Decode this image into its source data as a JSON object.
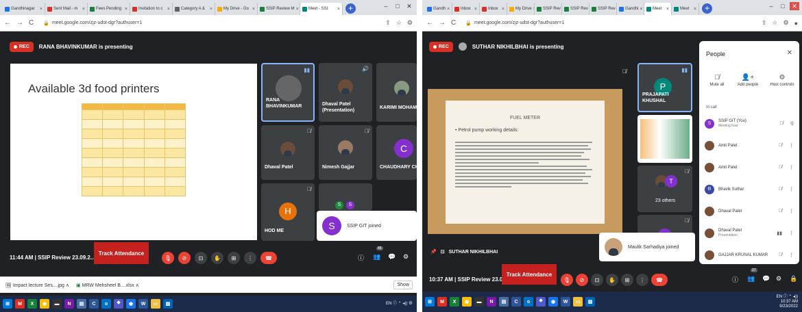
{
  "left": {
    "tabs": [
      {
        "label": "Gandhinagar",
        "color": "#1a73e8"
      },
      {
        "label": "Sent Mail - m",
        "color": "#d93025"
      },
      {
        "label": "Fees Pending",
        "color": "#188038"
      },
      {
        "label": "Invitation to c",
        "color": "#d93025"
      },
      {
        "label": "Category A & ",
        "color": "#5f6368"
      },
      {
        "label": "My Drive - Go",
        "color": "#f9ab00"
      },
      {
        "label": "SSIP Review M",
        "color": "#188038"
      },
      {
        "label": "Meet - SSI",
        "color": "#00897b"
      }
    ],
    "url": "meet.google.com/zjz-udst-dgr?authuser=1",
    "rec_label": "REC",
    "presenting_text": "RANA BHAVINKUMAR is presenting",
    "slide_title": "Available 3d food printers",
    "table_rows": 7,
    "tiles": [
      {
        "name": "RANA BHAVINKUMAR",
        "avatar": ""
      },
      {
        "name": "Dhaval Patel (Presentation)",
        "avatar": ""
      },
      {
        "name": "KARIMI MOHAM",
        "avatar": ""
      },
      {
        "name": "Dhaval Patel",
        "avatar": ""
      },
      {
        "name": "Nimesh Gajjar",
        "avatar": ""
      },
      {
        "name": "CHAUDHARY CH",
        "avatar": "C"
      },
      {
        "name": "HOD ME",
        "avatar": "H"
      }
    ],
    "joined": {
      "avatar": "S",
      "text": "SSIP GIT joined"
    },
    "meeting_info": "11:44 AM  |  SSIP Review 23.09.2...",
    "track_attendance": "Track Attendance",
    "people_count": "45",
    "downloads": [
      "Impact lecture Ses....jpg",
      "MRW Mehsheel B....xlsx"
    ],
    "show_all": "Show"
  },
  "right": {
    "tabs": [
      {
        "label": "Gandh",
        "color": "#1a73e8"
      },
      {
        "label": "Inbox",
        "color": "#d93025"
      },
      {
        "label": "Inbox",
        "color": "#d93025"
      },
      {
        "label": "My Drive",
        "color": "#f9ab00"
      },
      {
        "label": "SSIP Rev",
        "color": "#188038"
      },
      {
        "label": "SSIP Rev",
        "color": "#188038"
      },
      {
        "label": "SSIP Rev",
        "color": "#188038"
      },
      {
        "label": "Gandhi",
        "color": "#1a73e8"
      },
      {
        "label": "Meet",
        "color": "#00897b"
      },
      {
        "label": "Meet",
        "color": "#00897b"
      }
    ],
    "url": "meet.google.com/zjz-udst-dgr?authuser=1",
    "rec_label": "REC",
    "presenting_text": "SUTHAR NIKHILBHAI is presenting",
    "slide_title": "FUEL METER",
    "slide_bullet": "Petrol pump working details:",
    "tile_main": {
      "avatar": "P",
      "name": "PRAJAPATI KHUSHAL"
    },
    "others": "23 others",
    "presenter_name": "SUTHAR NIKHILBHAI",
    "joined": {
      "text": "Maulik Sarhadiya joined"
    },
    "meeting_info": "10:37 AM  |  SSIP Review 23.09.2...",
    "track_attendance": "Track Attendance",
    "people_count": "27",
    "people": {
      "title": "People",
      "actions": [
        "Mute all",
        "Add people",
        "Host controls"
      ],
      "section": "In call",
      "list": [
        {
          "name": "SSIP GIT (You)",
          "sub": "Meeting host",
          "avatar": "S"
        },
        {
          "name": "Amit Patel",
          "sub": "",
          "avatar": ""
        },
        {
          "name": "Amit Patel",
          "sub": "",
          "avatar": ""
        },
        {
          "name": "Bhavik Suthar",
          "sub": "",
          "avatar": "B"
        },
        {
          "name": "Dhaval Patel",
          "sub": "",
          "avatar": ""
        },
        {
          "name": "Dhaval Patel",
          "sub": "Presentation",
          "avatar": ""
        },
        {
          "name": "GAJJAR KRUNAL KUMAR",
          "sub": "",
          "avatar": ""
        }
      ]
    },
    "clock_time": "10:37 AM",
    "clock_date": "9/23/2022"
  }
}
